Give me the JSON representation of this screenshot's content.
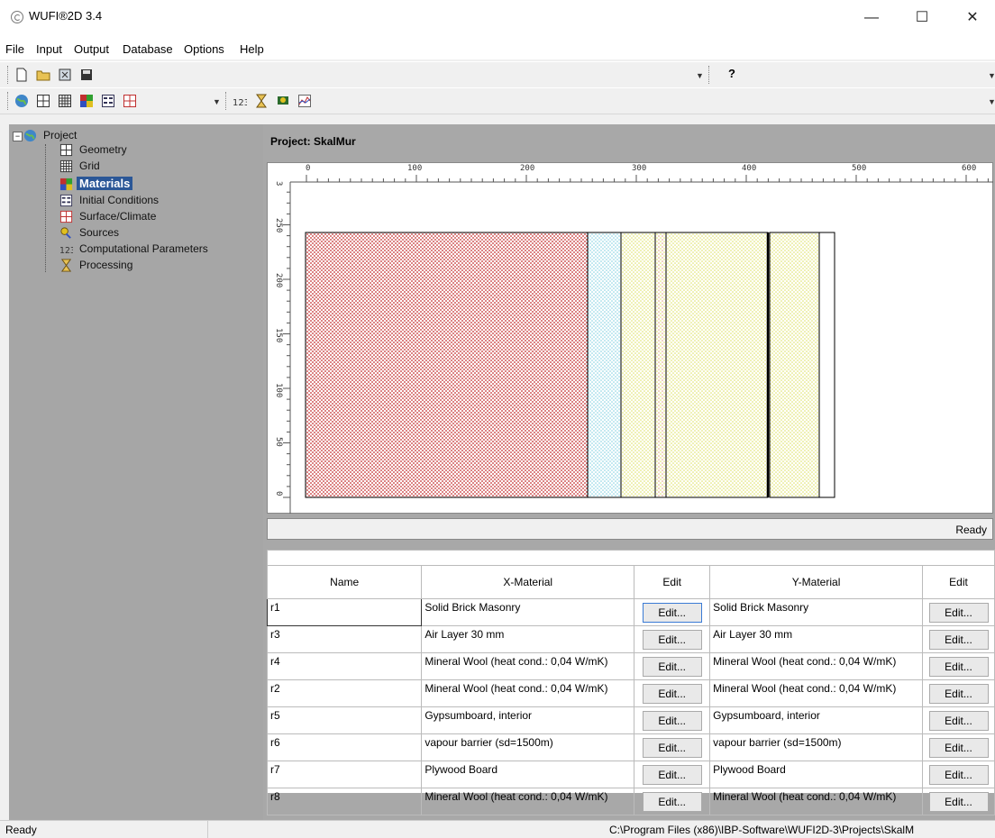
{
  "window": {
    "title": "WUFI®2D 3.4"
  },
  "menu": [
    "File",
    "Input",
    "Output",
    "Database",
    "Options",
    "Help"
  ],
  "toolbar": {
    "help_label": "?"
  },
  "tree": {
    "root": "Project",
    "items": [
      "Geometry",
      "Grid",
      "Materials",
      "Initial Conditions",
      "Surface/Climate",
      "Sources",
      "Computational Parameters",
      "Processing"
    ],
    "selected": "Materials"
  },
  "project": {
    "title": "Project: SkalMur"
  },
  "ruler": {
    "x_ticks": [
      "0",
      "100",
      "200",
      "300",
      "400",
      "500",
      "600"
    ],
    "y_ticks": [
      "0",
      "50",
      "100",
      "150",
      "200",
      "250",
      "3"
    ]
  },
  "canvas_status": "Ready",
  "table": {
    "headers": [
      "Name",
      "X-Material",
      "Edit",
      "Y-Material",
      "Edit"
    ],
    "edit_label": "Edit...",
    "rows": [
      {
        "name": "r1",
        "x": "Solid Brick Masonry",
        "y": "Solid Brick Masonry"
      },
      {
        "name": "r3",
        "x": "Air Layer 30 mm",
        "y": "Air Layer 30 mm"
      },
      {
        "name": "r4",
        "x": "Mineral Wool (heat cond.: 0,04 W/mK)",
        "y": "Mineral Wool (heat cond.: 0,04 W/mK)"
      },
      {
        "name": "r2",
        "x": "Mineral Wool (heat cond.: 0,04 W/mK)",
        "y": "Mineral Wool (heat cond.: 0,04 W/mK)"
      },
      {
        "name": "r5",
        "x": "Gypsumboard, interior",
        "y": "Gypsumboard, interior"
      },
      {
        "name": "r6",
        "x": "vapour barrier (sd=1500m)",
        "y": "vapour barrier (sd=1500m)"
      },
      {
        "name": "r7",
        "x": "Plywood Board",
        "y": "Plywood Board"
      },
      {
        "name": "r8",
        "x": "Mineral Wool (heat cond.: 0,04 W/mK)",
        "y": "Mineral Wool (heat cond.: 0,04 W/mK)"
      }
    ]
  },
  "statusbar": {
    "left": "Ready",
    "path": "C:\\Program Files (x86)\\IBP-Software\\WUFI2D-3\\Projects\\SkalM"
  }
}
